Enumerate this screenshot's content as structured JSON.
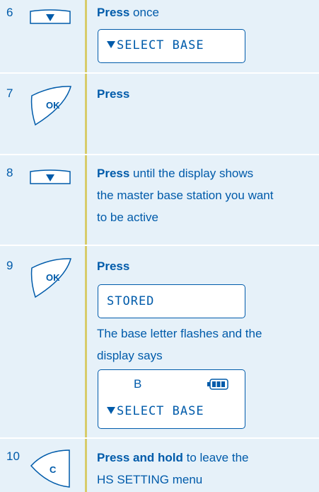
{
  "steps": [
    {
      "number": "6",
      "key": "down-arrow",
      "text_bold": "Press",
      "text_rest": " once",
      "display": {
        "line1": "SELECT BASE"
      }
    },
    {
      "number": "7",
      "key": "ok",
      "key_label": "OK",
      "text_bold": "Press",
      "text_rest": ""
    },
    {
      "number": "8",
      "key": "down-arrow",
      "text_bold": "Press",
      "text_rest": " until the display shows",
      "text_line2": "the master base station you want",
      "text_line3": "to be active"
    },
    {
      "number": "9",
      "key": "ok",
      "key_label": "OK",
      "text_bold": "Press",
      "text_rest": "",
      "display1": {
        "line1": "STORED"
      },
      "after_line1": "The base letter flashes and the",
      "after_line2": "display says",
      "display2": {
        "letter": "B",
        "battery": "battery-full-icon",
        "line2": "SELECT BASE"
      }
    },
    {
      "number": "10",
      "key": "c",
      "key_label": "C",
      "text_bold": "Press and hold",
      "text_rest": " to leave the",
      "text_line2": "HS SETTING menu"
    }
  ],
  "colors": {
    "text": "#005baa",
    "background": "#e6f1f9",
    "divider": "#d7cc6a"
  }
}
